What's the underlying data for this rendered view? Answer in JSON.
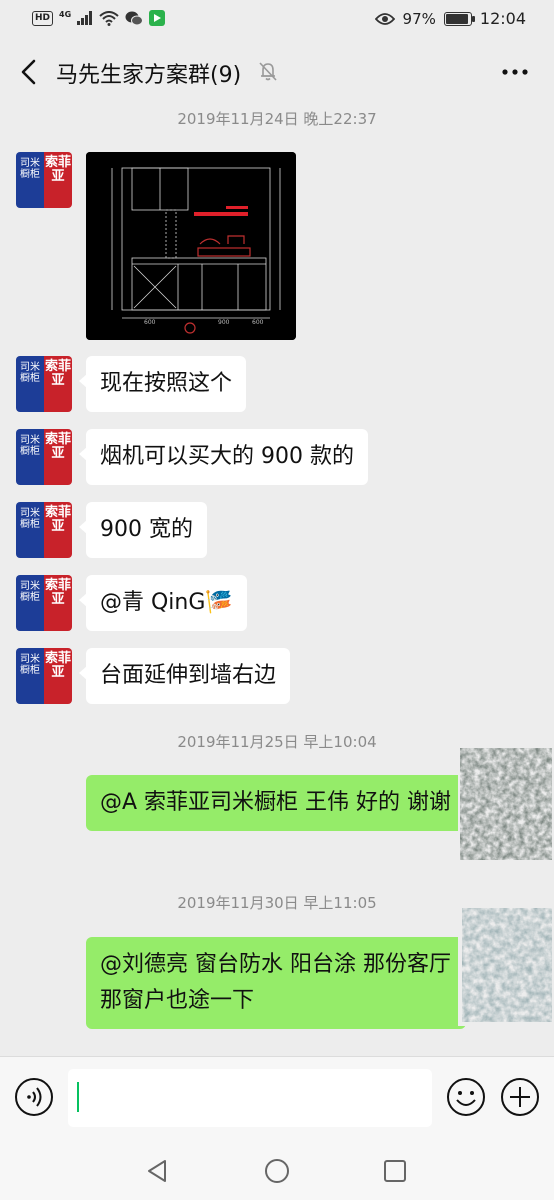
{
  "status_bar": {
    "hd": "HD",
    "network": "4G",
    "battery_percent": "97%",
    "battery_level": 0.97,
    "time": "12:04"
  },
  "header": {
    "title": "马先生家方案群(9)",
    "back_icon": "chevron-left-icon",
    "mute_icon": "bell-off-icon",
    "more_icon": "more-dots-icon"
  },
  "avatar": {
    "left_text": "司米橱柜",
    "right_text": "索菲亚"
  },
  "messages": [
    {
      "type": "timestamp",
      "text": "2019年11月24日 晚上22:37"
    },
    {
      "type": "image",
      "from": "other",
      "alt": "kitchen cabinet drawing"
    },
    {
      "type": "text",
      "from": "other",
      "text": "现在按照这个"
    },
    {
      "type": "text",
      "from": "other",
      "text": "烟机可以买大的 900 款的"
    },
    {
      "type": "text",
      "from": "other",
      "text": "900 宽的"
    },
    {
      "type": "text",
      "from": "other",
      "text": "@青 QinG🎏"
    },
    {
      "type": "text",
      "from": "other",
      "text": "台面延伸到墙右边"
    },
    {
      "type": "timestamp",
      "text": "2019年11月25日 早上10:04"
    },
    {
      "type": "text",
      "from": "self",
      "text": "@A 索菲亚司米橱柜  王伟  好的 谢谢"
    },
    {
      "type": "timestamp",
      "text": "2019年11月30日 早上11:05"
    },
    {
      "type": "text",
      "from": "self",
      "text": "@刘德亮  窗台防水 阳台涂 那份客厅那窗户也途一下"
    }
  ],
  "input_bar": {
    "voice_icon": "voice-icon",
    "input_value": "",
    "emoji_icon": "emoji-icon",
    "plus_icon": "plus-circle-icon"
  },
  "nav_bar": {
    "back_icon": "triangle-back-icon",
    "home_icon": "circle-home-icon",
    "recents_icon": "square-recents-icon"
  },
  "colors": {
    "background": "#ededed",
    "self_bubble": "#95ec69",
    "other_bubble": "#ffffff",
    "timestamp": "#8a8a8a",
    "caret": "#07c160"
  }
}
